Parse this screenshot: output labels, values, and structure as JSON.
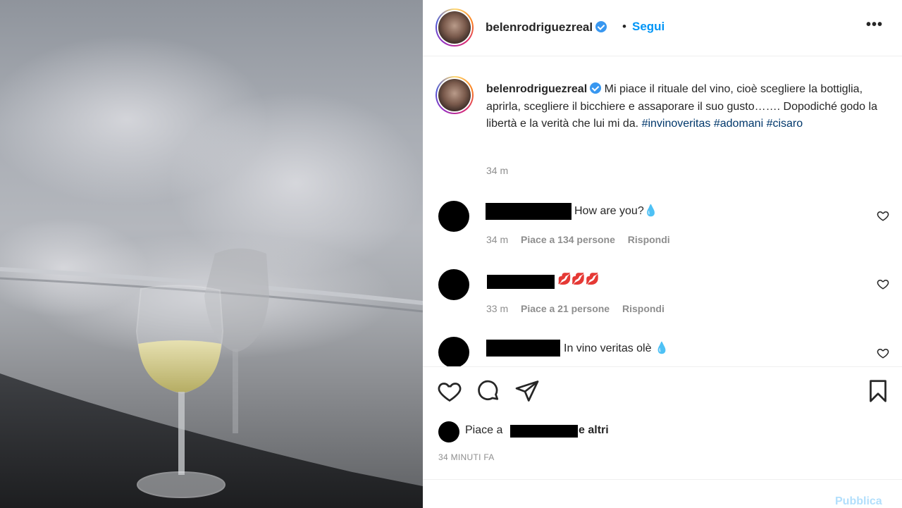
{
  "post": {
    "username": "belenrodriguezreal",
    "separator": "•",
    "follow_label": "Segui",
    "more_label": "•••"
  },
  "caption": {
    "username": "belenrodriguezreal",
    "text": "Mi piace il rituale del vino, cioè scegliere la bottiglia, aprirla, scegliere il bicchiere e assaporare il suo gusto……. Dopodiché godo la libertà e la verità che lui mi da.",
    "hashtags": [
      "#invinoveritas",
      "#adomani",
      "#cisaro"
    ],
    "time": "34 m"
  },
  "comments": [
    {
      "text": "How are you?💧",
      "time": "34 m",
      "likes": "Piace a 134 persone",
      "reply": "Rispondi"
    },
    {
      "text": "💋💋💋",
      "time": "33 m",
      "likes": "Piace a 21 persone",
      "reply": "Rispondi"
    },
    {
      "text": "In vino veritas olè 💧"
    }
  ],
  "likes_line": {
    "prefix": "Piace a",
    "suffix": "e altri"
  },
  "timeago": "34 MINUTI FA",
  "add_comment": {
    "publish_label": "Pubblica"
  },
  "icons": [
    "heart-icon",
    "comment-icon",
    "share-icon",
    "bookmark-icon",
    "verified-icon",
    "more-icon"
  ],
  "colors": {
    "link": "#0095f6",
    "hashtag": "#00376b",
    "muted": "#8e8e8e",
    "verified": "#3897f0"
  }
}
